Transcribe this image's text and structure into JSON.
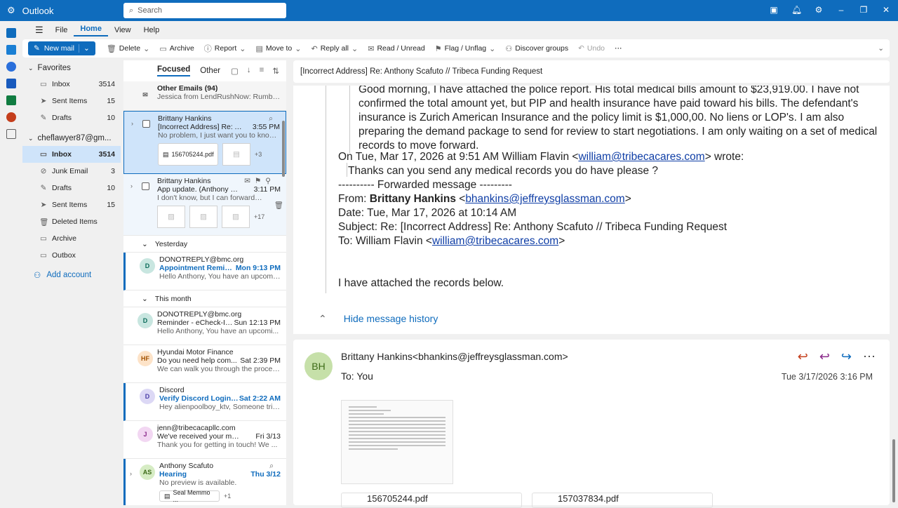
{
  "app": {
    "title": "Outlook"
  },
  "search": {
    "placeholder": "Search"
  },
  "menu": {
    "file": "File",
    "home": "Home",
    "view": "View",
    "help": "Help"
  },
  "ribbon": {
    "new_mail": "New mail",
    "delete": "Delete",
    "archive": "Archive",
    "report": "Report",
    "move_to": "Move to",
    "reply_all": "Reply all",
    "read_unread": "Read / Unread",
    "flag": "Flag / Unflag",
    "discover": "Discover groups",
    "undo": "Undo"
  },
  "nav": {
    "favorites": "Favorites",
    "fav_items": [
      {
        "label": "Inbox",
        "count": "3514"
      },
      {
        "label": "Sent Items",
        "count": "15"
      },
      {
        "label": "Drafts",
        "count": "10"
      }
    ],
    "account": "cheflawyer87@gm...",
    "acc_items": [
      {
        "label": "Inbox",
        "count": "3514"
      },
      {
        "label": "Junk Email",
        "count": "3"
      },
      {
        "label": "Drafts",
        "count": "10"
      },
      {
        "label": "Sent Items",
        "count": "15"
      },
      {
        "label": "Deleted Items",
        "count": ""
      },
      {
        "label": "Archive",
        "count": ""
      },
      {
        "label": "Outbox",
        "count": ""
      }
    ],
    "add_account": "Add account"
  },
  "list": {
    "tab_focused": "Focused",
    "tab_other": "Other",
    "other_emails": {
      "title": "Other Emails (94)",
      "preview": "Jessica from LendRushNow: Rumble: Lendi..."
    },
    "messages_top": [
      {
        "from": "Brittany Hankins",
        "subject": "[Incorrect Address] Re: Ant...",
        "date": "3:55 PM",
        "preview": "No problem, I just want you to know...",
        "attachment": "156705244.pdf",
        "more": "+3"
      },
      {
        "from": "Brittany Hankins",
        "subject": "App update. (Anthony Scaf...",
        "date": "3:11 PM",
        "preview": "I don't know, but I can forward you t...",
        "more": "+17"
      }
    ],
    "section_yesterday": "Yesterday",
    "msg_yesterday": {
      "initial": "D",
      "from": "DONOTREPLY@bmc.org",
      "subject": "Appointment Remind...",
      "date": "Mon 9:13 PM",
      "preview": "Hello Anthony, You have an upcomi..."
    },
    "section_month": "This month",
    "messages_month": [
      {
        "initial": "D",
        "from": "DONOTREPLY@bmc.org",
        "subject": "Reminder - eCheck-In...",
        "date": "Sun 12:13 PM",
        "preview": "Hello Anthony, You have an upcomi..."
      },
      {
        "initial": "HF",
        "from": "Hyundai Motor Finance",
        "subject": "Do you need help com...",
        "date": "Sat 2:39 PM",
        "preview": "We can walk you through the proces..."
      },
      {
        "initial": "D",
        "from": "Discord",
        "subject": "Verify Discord Login fr...",
        "date": "Sat 2:22 AM",
        "preview": "Hey alienpoolboy_ktv, Someone trie..."
      },
      {
        "initial": "J",
        "from": "jenn@tribecacapllc.com",
        "subject": "We've received your messa...",
        "date": "Fri 3/13",
        "preview": "Thank you for getting in touch! We ..."
      },
      {
        "initial": "AS",
        "from": "Anthony Scafuto",
        "subject": "Hearing",
        "date": "Thu 3/12",
        "preview": "No preview is available.",
        "attachment": "Seal Memmo ...",
        "more": "+1"
      }
    ]
  },
  "reading": {
    "subject": "[Incorrect Address] Re: Anthony Scafuto // Tribeca Funding Request",
    "quoted_text": "Good morning, I have attached the police report. His total medical bills amount to $23,919.00. I have not confirmed the total amount yet, but PIP and health insurance have paid toward his bills. The defendant's insurance is Zurich American Insurance and the policy limit is $1,000,00. No liens or LOP's. I am also preparing the demand package to send for review to start negotiations. I am only waiting on a set of medical records to move forward.",
    "on_date": "On Tue, Mar 17, 2026 at 9:51 AM William Flavin <",
    "on_email": "william@tribecacares.com",
    "on_wrote": "> wrote:",
    "thanks": "Thanks can you send any medical records you do have please ?",
    "forwarded": "---------- Forwarded message ---------",
    "from_label": "From: ",
    "from_name": "Brittany Hankins",
    "from_lt": " <",
    "from_email": "bhankins@jeffreysglassman.com",
    "from_gt": ">",
    "date_line": "Date: Tue, Mar 17, 2026 at 10:14 AM",
    "subject_line": "Subject: Re: [Incorrect Address] Re: Anthony Scafuto // Tribeca Funding Request",
    "to_label": "To: William Flavin <",
    "to_email": "william@tribecacares.com",
    "to_gt": ">",
    "attached_line": "I have attached the records below.",
    "hide_history": "Hide message history",
    "sender_initials": "BH",
    "sender": "Brittany Hankins<bhankins@jeffreysglassman.com>",
    "to": "To:  You",
    "date": "Tue 3/17/2026 3:16 PM",
    "attachment1": "156705244.pdf",
    "attachment2": "157037834.pdf"
  }
}
